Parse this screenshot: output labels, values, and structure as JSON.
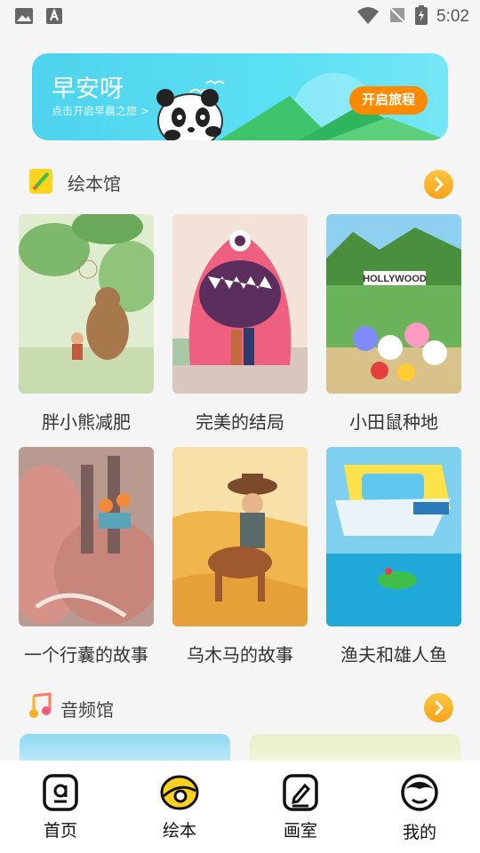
{
  "status_bar": {
    "time": "5:02"
  },
  "banner": {
    "title": "早安呀",
    "subtitle": "点击开启早晨之旅 >",
    "button": "开启旅程"
  },
  "picture_books": {
    "title": "绘本馆",
    "books": [
      {
        "title": "胖小熊减肥"
      },
      {
        "title": "完美的结局"
      },
      {
        "title": "小田鼠种地"
      },
      {
        "title": "一个行囊的故事"
      },
      {
        "title": "乌木马的故事"
      },
      {
        "title": "渔夫和雄人鱼"
      }
    ]
  },
  "audio": {
    "title": "音频馆"
  },
  "tabs": [
    {
      "label": "首页"
    },
    {
      "label": "绘本"
    },
    {
      "label": "画室"
    },
    {
      "label": "我的"
    }
  ]
}
